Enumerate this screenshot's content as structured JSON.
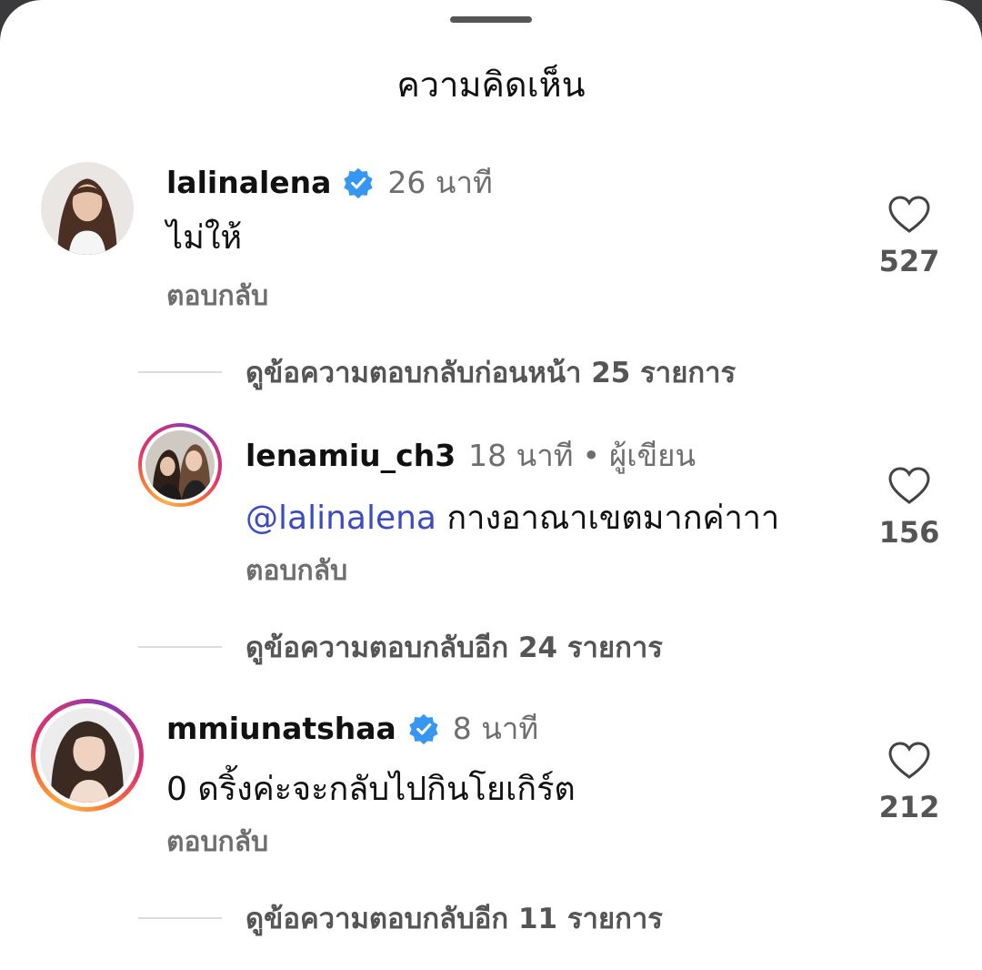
{
  "sheet": {
    "title": "ความคิดเห็น"
  },
  "comments": [
    {
      "username": "lalinalena",
      "time": "26 นาที",
      "text": "ไม่ให้",
      "reply_label": "ตอบกลับ",
      "likes": "527",
      "view_replies": "ดูข้อความตอบกลับก่อนหน้า 25 รายการ"
    },
    {
      "username": "lenamiu_ch3",
      "time": "18 นาที",
      "separator": "•",
      "author_tag": "ผู้เขียน",
      "mention": "@lalinalena",
      "text": " กางอาณาเขตมากค่าาา",
      "reply_label": "ตอบกลับ",
      "likes": "156",
      "view_replies": "ดูข้อความตอบกลับอีก 24 รายการ"
    },
    {
      "username": "mmiunatshaa",
      "time": "8 นาที",
      "text": "0 ดริ้งค่ะจะกลับไปกินโยเกิร์ต",
      "reply_label": "ตอบกลับ",
      "likes": "212",
      "view_replies": "ดูข้อความตอบกลับอีก 11 รายการ"
    }
  ],
  "colors": {
    "verified": "#3797f0",
    "mention": "#3b4cc0",
    "secondary_text": "#6e6e6e"
  },
  "icons": [
    "heart-icon",
    "verified-badge-icon"
  ]
}
